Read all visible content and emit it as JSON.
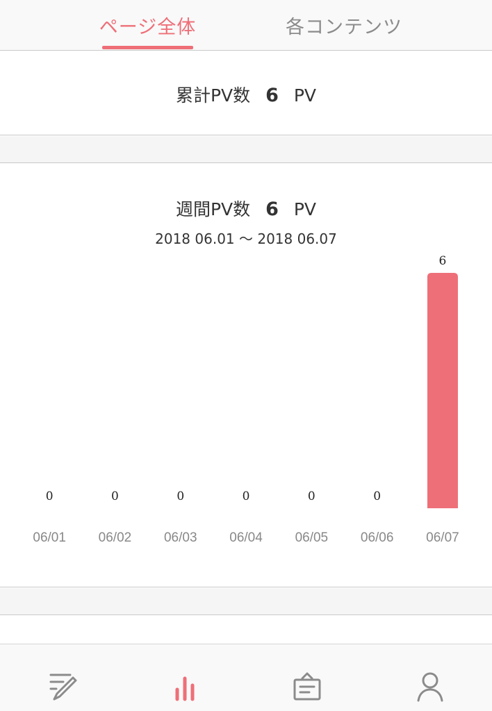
{
  "tabs": [
    {
      "label": "ページ全体",
      "active": true
    },
    {
      "label": "各コンテンツ",
      "active": false
    }
  ],
  "total": {
    "label": "累計PV数",
    "value": "6",
    "unit": "PV"
  },
  "weekly": {
    "label": "週間PV数",
    "value": "6",
    "unit": "PV",
    "range": "2018 06.01 〜 2018 06.07"
  },
  "chart_data": {
    "type": "bar",
    "categories": [
      "06/01",
      "06/02",
      "06/03",
      "06/04",
      "06/05",
      "06/06",
      "06/07"
    ],
    "values": [
      0,
      0,
      0,
      0,
      0,
      0,
      6
    ],
    "color": "#ee6f78"
  },
  "bottom_nav": [
    {
      "icon": "edit-icon",
      "active": false
    },
    {
      "icon": "analytics-icon",
      "active": true
    },
    {
      "icon": "inbox-icon",
      "active": false
    },
    {
      "icon": "user-icon",
      "active": false
    }
  ],
  "colors": {
    "accent": "#ee6f78",
    "inactive": "#8b8b8b"
  }
}
